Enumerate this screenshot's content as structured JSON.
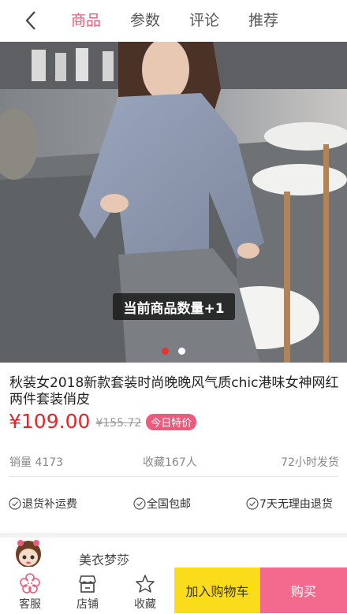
{
  "header": {
    "tabs": [
      {
        "label": "商品",
        "active": true
      },
      {
        "label": "参数",
        "active": false
      },
      {
        "label": "评论",
        "active": false
      },
      {
        "label": "推荐",
        "active": false
      }
    ]
  },
  "carousel": {
    "toast": "当前商品数量+1",
    "slide_count": 2,
    "active_slide": 1
  },
  "product": {
    "title": "秋装女2018新款套装时尚晚晚风气质chic港味女神网红两件套装俏皮",
    "price": "¥109.00",
    "original_price": "¥155.72",
    "badge": "今日特价",
    "sales": "销量 4173",
    "favorites": "收藏167人",
    "shipping": "72小时发货"
  },
  "guarantees": [
    "退货补运费",
    "全国包邮",
    "7天无理由退货"
  ],
  "shop": {
    "name": "美衣梦莎"
  },
  "bottom_bar": {
    "service": "客服",
    "store": "店铺",
    "favorite": "收藏",
    "add_cart": "加入购物车",
    "buy": "购买"
  },
  "colors": {
    "accent": "#ec5a7c",
    "price": "#e5242a",
    "cart": "#fadc1a",
    "buy": "#f46a8e"
  }
}
